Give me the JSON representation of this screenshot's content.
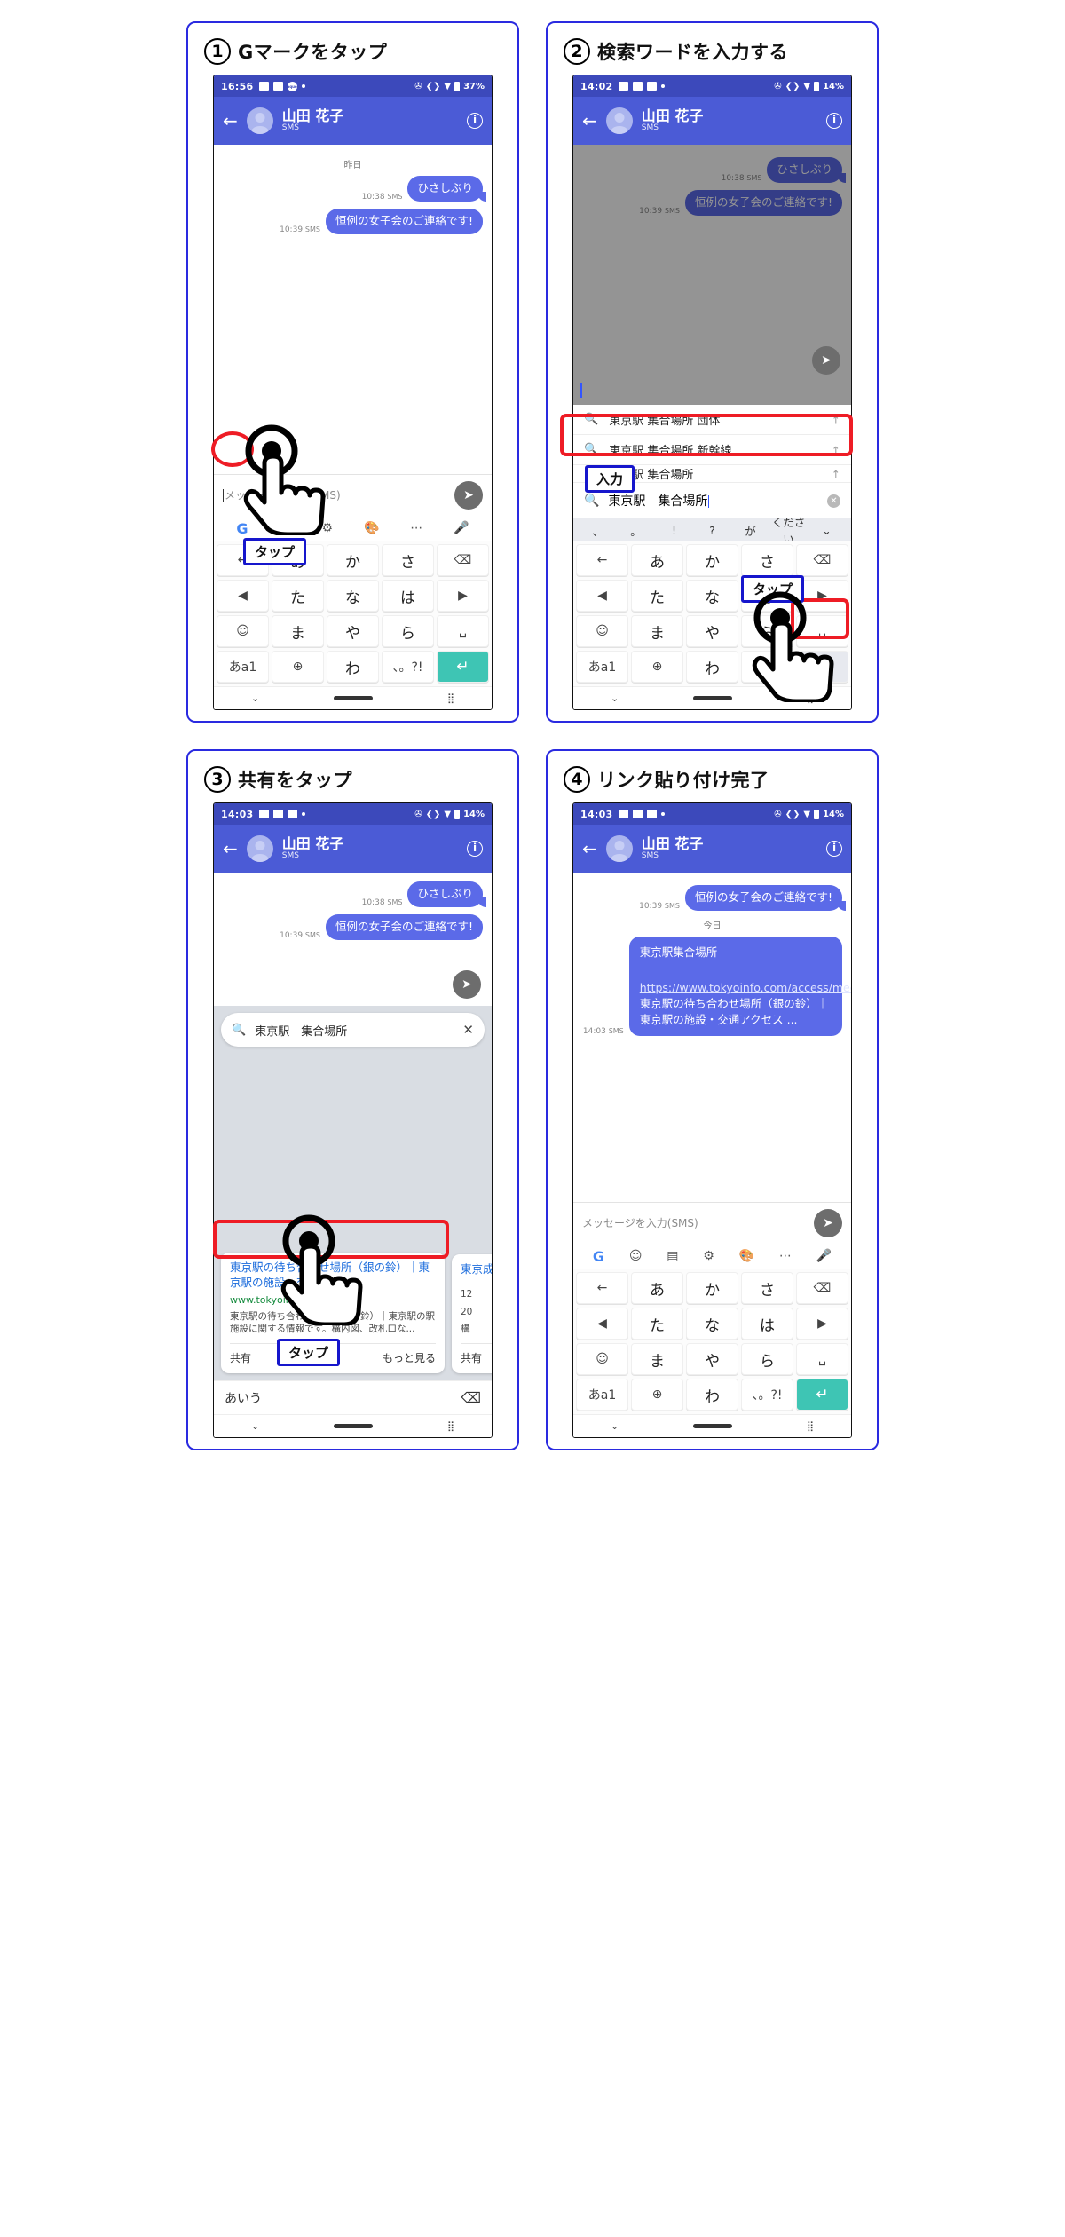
{
  "panels": [
    {
      "number": "1",
      "title": "Gマークをタップ",
      "status": {
        "time": "16:56",
        "battery": "37%"
      },
      "appbar": {
        "name": "山田 花子",
        "sub": "SMS"
      },
      "thread": {
        "day": "昨日",
        "messages": [
          {
            "time": "10:38",
            "kind": "SMS",
            "text": "ひさしぶり"
          },
          {
            "time": "10:39",
            "kind": "SMS",
            "text": "恒例の女子会のご連絡です!"
          }
        ]
      },
      "composer": {
        "placeholder": "メッセージを入力(SMS)"
      },
      "toolbar": [
        "G",
        "clipboard-icon",
        "gear-icon",
        "palette-icon",
        "more-icon",
        "mic-icon"
      ],
      "keyboard": [
        [
          "←",
          "あ",
          "か",
          "さ",
          "⌫"
        ],
        [
          "◀",
          "た",
          "な",
          "は",
          "▶"
        ],
        [
          "☺",
          "ま",
          "や",
          "ら",
          "␣"
        ],
        [
          "あa1",
          "⊕",
          "わ",
          "、。?!",
          "↵"
        ]
      ],
      "annotations": {
        "tap_label": "タップ"
      }
    },
    {
      "number": "2",
      "title": "検索ワードを入力する",
      "status": {
        "time": "14:02",
        "battery": "14%"
      },
      "appbar": {
        "name": "山田 花子",
        "sub": "SMS"
      },
      "thread": {
        "messages": [
          {
            "time": "10:38",
            "kind": "SMS",
            "text": "ひさしぶり"
          },
          {
            "time": "10:39",
            "kind": "SMS",
            "text": "恒例の女子会のご連絡です!"
          }
        ]
      },
      "suggestions": [
        "東京駅 集合場所 団体",
        "東京駅 集合場所 新幹線",
        "東京駅 集合場所"
      ],
      "search_value": "東京駅　集合場所",
      "prediction_bar": [
        "、",
        "。",
        "!",
        "?",
        "が",
        "ください",
        "⌄"
      ],
      "keyboard": [
        [
          "←",
          "あ",
          "か",
          "さ",
          "⌫"
        ],
        [
          "◀",
          "た",
          "な",
          "は",
          "▶"
        ],
        [
          "☺",
          "ま",
          "や",
          "ら",
          "␣"
        ],
        [
          "あa1",
          "⊕",
          "わ",
          "、。?!",
          "🔍"
        ]
      ],
      "annotations": {
        "input_label": "入力",
        "tap_label": "タップ"
      }
    },
    {
      "number": "3",
      "title": "共有をタップ",
      "status": {
        "time": "14:03",
        "battery": "14%"
      },
      "appbar": {
        "name": "山田 花子",
        "sub": "SMS"
      },
      "thread": {
        "messages": [
          {
            "time": "10:38",
            "kind": "SMS",
            "text": "ひさしぶり"
          },
          {
            "time": "10:39",
            "kind": "SMS",
            "text": "恒例の女子会のご連絡です!"
          }
        ]
      },
      "search_value": "東京駅　集合場所",
      "result_card": {
        "title": "東京駅の待ち合わせ場所（銀の鈴）｜東京駅の施設・交通アクセ...",
        "url": "www.tokyoinfo.com",
        "desc": "東京駅の待ち合わせ場所（銀の鈴）｜東京駅の駅施設に関する情報です。構内図、改札口な...",
        "share_label": "共有",
        "more_label": "もっと見る"
      },
      "result_card_partial": {
        "title": "東京成",
        "meta1": "12",
        "meta2": "20",
        "meta3": "構",
        "share_label": "共有"
      },
      "kbd_left_label": "あいう",
      "annotations": {
        "tap_label": "タップ"
      }
    },
    {
      "number": "4",
      "title": "リンク貼り付け完了",
      "status": {
        "time": "14:03",
        "battery": "14%"
      },
      "appbar": {
        "name": "山田 花子",
        "sub": "SMS"
      },
      "thread": {
        "day": "今日",
        "messages": [
          {
            "time": "10:39",
            "kind": "SMS",
            "text": "恒例の女子会のご連絡です!"
          }
        ],
        "sent": {
          "header": "東京駅集合場所",
          "url": "https://www.tokyoinfo.com/access/meeting_place.html",
          "caption": "東京駅の待ち合わせ場所（銀の鈴）｜東京駅の施設・交通アクセス ...",
          "time": "14:03",
          "kind": "SMS"
        }
      },
      "composer": {
        "placeholder": "メッセージを入力(SMS)"
      },
      "toolbar": [
        "G",
        "sticker-icon",
        "clipboard-icon",
        "gear-icon",
        "palette-icon",
        "more-icon",
        "mic-icon"
      ],
      "keyboard": [
        [
          "←",
          "あ",
          "か",
          "さ",
          "⌫"
        ],
        [
          "◀",
          "た",
          "な",
          "は",
          "▶"
        ],
        [
          "☺",
          "ま",
          "や",
          "ら",
          "␣"
        ],
        [
          "あa1",
          "⊕",
          "わ",
          "、。?!",
          "↵"
        ]
      ]
    }
  ],
  "colors": {
    "accent_blue": "#4b5bd6",
    "bubble_blue": "#5b6ae8",
    "annotation_red": "#ee1c25",
    "annotation_blue": "#1616cc",
    "teal_key": "#3ec5b4"
  }
}
